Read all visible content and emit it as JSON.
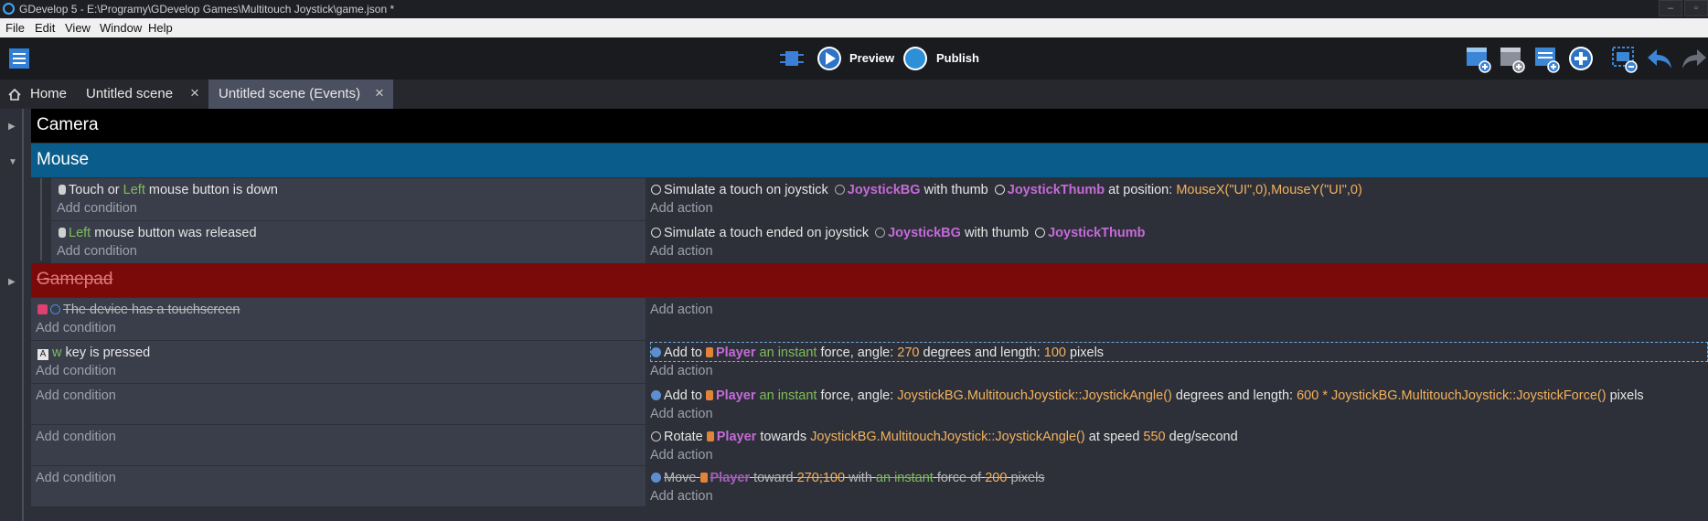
{
  "window": {
    "title": "GDevelop 5 - E:\\Programy\\GDevelop Games\\Multitouch Joystick\\game.json *"
  },
  "menu": [
    "File",
    "Edit",
    "View",
    "Window",
    "Help"
  ],
  "toolbar": {
    "preview_label": "Preview",
    "publish_label": "Publish"
  },
  "tabs": [
    {
      "label": "Home"
    },
    {
      "label": "Untitled scene"
    },
    {
      "label": "Untitled scene (Events)"
    }
  ],
  "colors": {
    "camera_group": "#000000",
    "mouse_group": "#0a5d8a",
    "gamepad_group": "#7a0a0a",
    "object": "#c56ad9",
    "param": "#f2b15e",
    "keyword": "#7fbd5b"
  },
  "groups": {
    "camera": "Camera",
    "mouse": "Mouse",
    "gamepad": "Gamepad"
  },
  "common": {
    "add_condition": "Add condition",
    "add_action": "Add action"
  },
  "events": {
    "e1": {
      "cond_touch": "Touch or",
      "cond_left": "Left",
      "cond_rest": "mouse button is down",
      "act_pre": "Simulate a touch on joystick",
      "act_obj1": "JoystickBG",
      "act_mid": "with thumb",
      "act_obj2": "JoystickThumb",
      "act_pos": "at position:",
      "act_params": "MouseX(\"UI\",0),MouseY(\"UI\",0)"
    },
    "e2": {
      "cond_left": "Left",
      "cond_rest": "mouse button was released",
      "act_pre": "Simulate a touch ended on joystick",
      "act_obj1": "JoystickBG",
      "act_mid": "with thumb",
      "act_obj2": "JoystickThumb"
    },
    "e3": {
      "cond": "The device has a touchscreen"
    },
    "e4": {
      "cond_key": "w",
      "cond_rest": "key is pressed",
      "act_pre": "Add to",
      "act_obj": "Player",
      "act_kw": "an instant",
      "act_a": "force, angle:",
      "act_angle": "270",
      "act_b": "degrees and length:",
      "act_len": "100",
      "act_c": "pixels"
    },
    "e5": {
      "act_pre": "Add to",
      "act_obj": "Player",
      "act_kw": "an instant",
      "act_a": "force, angle:",
      "act_angle": "JoystickBG.MultitouchJoystick::JoystickAngle()",
      "act_b": "degrees and length:",
      "act_len_num": "600 *",
      "act_len": "JoystickBG.MultitouchJoystick::JoystickForce()",
      "act_c": "pixels"
    },
    "e6": {
      "act_pre": "Rotate",
      "act_obj": "Player",
      "act_a": "towards",
      "act_angle": "JoystickBG.MultitouchJoystick::JoystickAngle()",
      "act_b": "at speed",
      "act_speed": "550",
      "act_c": "deg/second"
    },
    "e7": {
      "act_pre": "Move",
      "act_obj": "Player",
      "act_a": "toward",
      "act_pos": "270;100",
      "act_b": "with",
      "act_kw": "an instant",
      "act_c": "force of",
      "act_force": "200",
      "act_d": "pixels"
    }
  }
}
